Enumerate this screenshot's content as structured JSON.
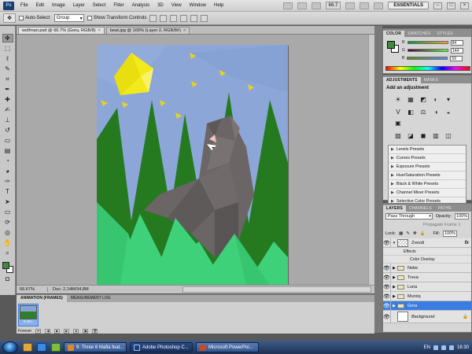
{
  "app": {
    "logo": "Ps",
    "menus": [
      "File",
      "Edit",
      "Image",
      "Layer",
      "Select",
      "Filter",
      "Analysis",
      "3D",
      "View",
      "Window",
      "Help"
    ],
    "zoom_display": "66.7",
    "workspace": "ESSENTIALS"
  },
  "options_bar": {
    "auto_select_label": "Auto-Select:",
    "auto_select_value": "Group",
    "show_transform_label": "Show Transform Controls"
  },
  "document": {
    "tabs": [
      {
        "label": "wolfman.psd @ 66.7% (Gora, RGB/8)",
        "close": "×"
      },
      {
        "label": "beat.jpg @ 100% (Layer 2, RGB/8#)",
        "close": "×"
      }
    ],
    "status_zoom": "66.67%",
    "status_doc": "Doc: 2,14M/34,8M"
  },
  "color_panel": {
    "tabs": [
      "COLOR",
      "SWATCHES",
      "STYLES"
    ],
    "fg_color": "#3d8a3a",
    "channels": [
      {
        "label": "R",
        "value": "84"
      },
      {
        "label": "G",
        "value": "144"
      },
      {
        "label": "B",
        "value": "59"
      }
    ]
  },
  "adjustments_panel": {
    "tabs": [
      "ADJUSTMENTS",
      "MASKS"
    ],
    "title": "Add an adjustment",
    "icons_row1": [
      "☀",
      "▦",
      "◩",
      "◐",
      "▾"
    ],
    "icons_row2": [
      "V",
      "◧",
      "⚖",
      "◑",
      "◒",
      "▣"
    ],
    "icons_row3": [
      "▨",
      "◪",
      "◼",
      "▥",
      "◫"
    ],
    "presets": [
      "Levels Presets",
      "Curves Presets",
      "Exposure Presets",
      "Hue/Saturation Presets",
      "Black & White Presets",
      "Channel Mixer Presets",
      "Selective Color Presets"
    ]
  },
  "layers_panel": {
    "tabs": [
      "LAYERS",
      "CHANNELS",
      "PATHS"
    ],
    "blend_mode": "Pass Through",
    "opacity_label": "Opacity:",
    "opacity_value": "100%",
    "lock_label": "Lock:",
    "fill_label": "Fill:",
    "fill_value": "100%",
    "unify_label": "Propagate Frame 1",
    "layers": [
      {
        "name": "Zvezdi",
        "type": "layer",
        "fx": "fx"
      },
      {
        "name": "Nebe",
        "type": "group"
      },
      {
        "name": "Treva",
        "type": "group"
      },
      {
        "name": "Luna",
        "type": "group"
      },
      {
        "name": "Murxiq",
        "type": "group"
      },
      {
        "name": "Gora",
        "type": "group",
        "selected": true
      },
      {
        "name": "Background",
        "type": "background"
      }
    ],
    "effects_label": "Effects",
    "effect_name": "Color Overlay"
  },
  "animation_panel": {
    "tabs": [
      "ANIMATION (FRAMES)",
      "MEASUREMENT LOG"
    ],
    "frame_number": "1",
    "frame_time": "0 sec.",
    "loop": "Forever"
  },
  "taskbar": {
    "buttons": [
      {
        "label": "9. Three 6 Mafia feat...",
        "color": "#d98a2b"
      },
      {
        "label": "Adobe Photoshop C...",
        "color": "#1c3e6e",
        "active": true
      },
      {
        "label": "Microsoft PowerPoi...",
        "color": "#c64a26"
      }
    ],
    "lang": "EN",
    "time": "16:30"
  }
}
